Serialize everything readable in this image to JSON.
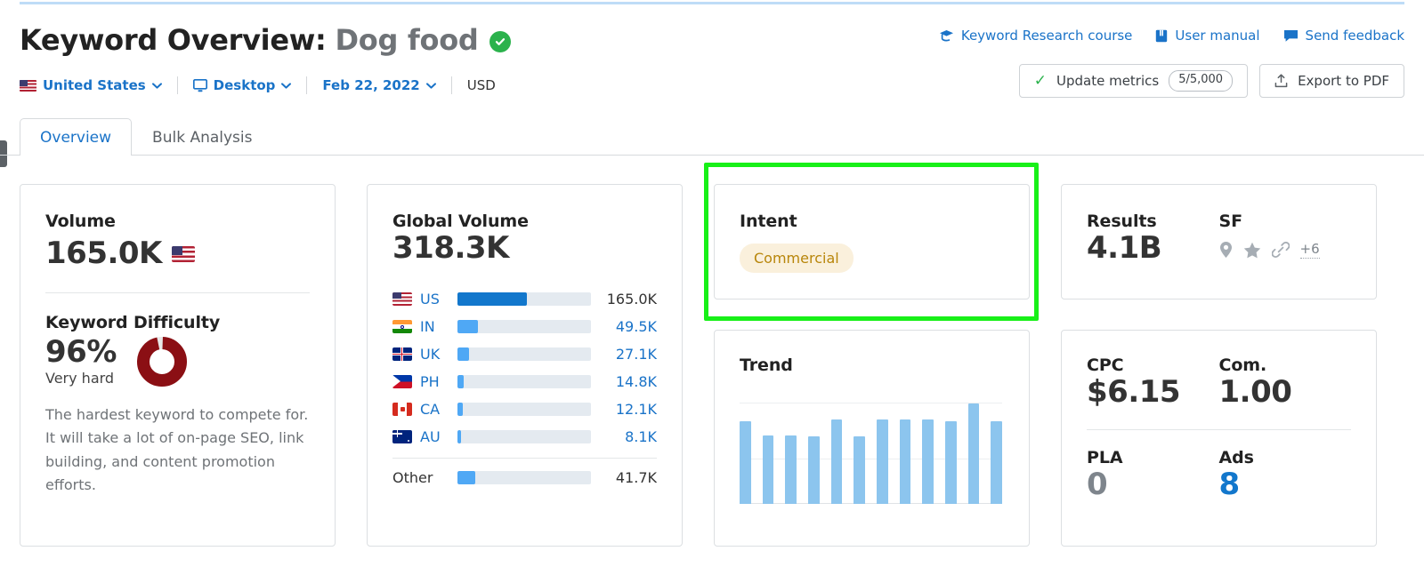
{
  "header": {
    "title_prefix": "Keyword Overview:",
    "keyword": "Dog food",
    "verified_icon": "check-circle-icon",
    "filters": [
      {
        "icon": "us-flag-icon",
        "label": "United States",
        "has_chevron": true
      },
      {
        "icon": "desktop-icon",
        "label": "Desktop",
        "has_chevron": true
      },
      {
        "icon": "",
        "label": "Feb 22, 2022",
        "has_chevron": true
      },
      {
        "icon": "",
        "label": "USD",
        "has_chevron": false
      }
    ],
    "links": [
      {
        "icon": "graduation-cap-icon",
        "label": "Keyword Research course"
      },
      {
        "icon": "book-icon",
        "label": "User manual"
      },
      {
        "icon": "speech-bubble-icon",
        "label": "Send feedback"
      }
    ],
    "buttons": {
      "update_metrics": {
        "icon": "check-icon",
        "label": "Update metrics",
        "pill": "5/5,000"
      },
      "export_pdf": {
        "icon": "upload-icon",
        "label": "Export to PDF"
      }
    }
  },
  "tabs": [
    {
      "label": "Overview",
      "active": true
    },
    {
      "label": "Bulk Analysis",
      "active": false
    }
  ],
  "cards": {
    "volume": {
      "label": "Volume",
      "value": "165.0K",
      "flag_icon": "us-flag-icon",
      "difficulty": {
        "label": "Keyword Difficulty",
        "percent": "96%",
        "percent_number": 96,
        "rating": "Very hard",
        "donut_color": "#8b0f14",
        "description": "The hardest keyword to compete for. It will take a lot of on-page SEO, link building, and content promotion efforts."
      }
    },
    "global_volume": {
      "label": "Global Volume",
      "value": "318.3K",
      "other_label": "Other"
    },
    "intent": {
      "label": "Intent",
      "badge": "Commercial",
      "badge_bg": "#faf0dc",
      "badge_color": "#b8860b",
      "highlight_color": "#18f018"
    },
    "results": {
      "label": "Results",
      "value": "4.1B",
      "sf_label": "SF",
      "sf_icons": [
        "map-pin-icon",
        "star-icon",
        "link-icon"
      ],
      "sf_more": "+6"
    },
    "trend": {
      "label": "Trend"
    },
    "cpc": {
      "cpc_label": "CPC",
      "cpc_value": "$6.15",
      "com_label": "Com.",
      "com_value": "1.00",
      "pla_label": "PLA",
      "pla_value": "0",
      "ads_label": "Ads",
      "ads_value": "8"
    }
  },
  "chart_data": [
    {
      "type": "bar",
      "title": "Global Volume",
      "orientation": "horizontal",
      "categories": [
        "US",
        "IN",
        "UK",
        "PH",
        "CA",
        "AU",
        "Other"
      ],
      "value_labels": [
        "165.0K",
        "49.5K",
        "27.1K",
        "14.8K",
        "12.1K",
        "8.1K",
        "41.7K"
      ],
      "values": [
        165000,
        49500,
        27100,
        14800,
        12100,
        8100,
        41700
      ],
      "max_scale": 318300,
      "bar_pct": [
        51.8,
        15.6,
        8.5,
        4.6,
        3.8,
        2.5,
        13.1
      ],
      "colors": [
        "#1277cc",
        "#4fa8f5",
        "#4fa8f5",
        "#4fa8f5",
        "#4fa8f5",
        "#4fa8f5",
        "#4fa8f5"
      ],
      "track_color": "#e4eaf0",
      "grid": false,
      "legend": "none",
      "total": "318.3K"
    },
    {
      "type": "bar",
      "title": "Trend",
      "categories": [
        "1",
        "2",
        "3",
        "4",
        "5",
        "6",
        "7",
        "8",
        "9",
        "10",
        "11",
        "12"
      ],
      "values": [
        76,
        63,
        63,
        62,
        77,
        62,
        77,
        77,
        77,
        76,
        92,
        76
      ],
      "ylim": [
        0,
        100
      ],
      "grid": true,
      "gridlines_pct": [
        92,
        41
      ],
      "bar_color": "#8cc5ee",
      "xlabel": "",
      "ylabel": "",
      "legend": "none"
    },
    {
      "type": "pie",
      "title": "Keyword Difficulty",
      "labels": [
        "Difficulty",
        "Remaining"
      ],
      "values": [
        96,
        4
      ],
      "colors": [
        "#8b0f14",
        "#e8e8e8"
      ],
      "center_label": "96%",
      "donut": true
    }
  ],
  "global_rows": [
    {
      "flag": "us-flag-icon",
      "code": "US",
      "bar_pct": 51.8,
      "value": "165.0K",
      "primary": true
    },
    {
      "flag": "in-flag-icon",
      "code": "IN",
      "bar_pct": 15.6,
      "value": "49.5K",
      "primary": false
    },
    {
      "flag": "uk-flag-icon",
      "code": "UK",
      "bar_pct": 8.5,
      "value": "27.1K",
      "primary": false
    },
    {
      "flag": "ph-flag-icon",
      "code": "PH",
      "bar_pct": 4.6,
      "value": "14.8K",
      "primary": false
    },
    {
      "flag": "ca-flag-icon",
      "code": "CA",
      "bar_pct": 3.8,
      "value": "12.1K",
      "primary": false
    },
    {
      "flag": "au-flag-icon",
      "code": "AU",
      "bar_pct": 2.5,
      "value": "8.1K",
      "primary": false
    }
  ],
  "global_other": {
    "code": "Other",
    "bar_pct": 13.1,
    "value": "41.7K"
  }
}
